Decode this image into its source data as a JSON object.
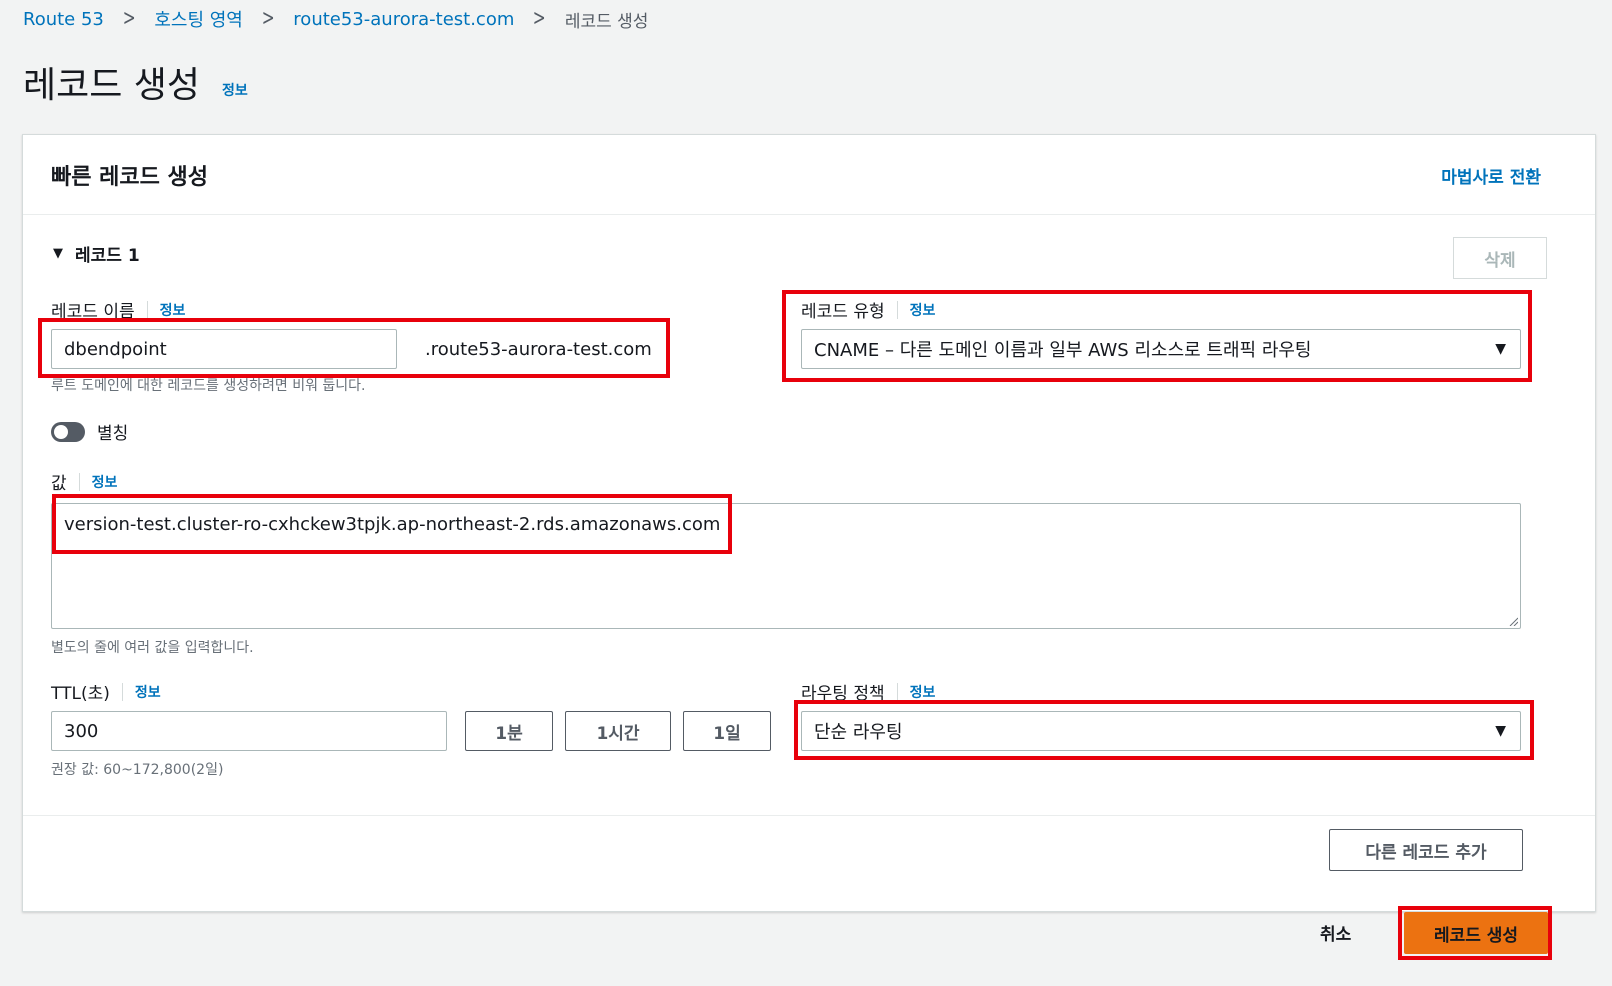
{
  "breadcrumb": {
    "items": [
      "Route 53",
      "호스팅 영역",
      "route53-aurora-test.com",
      "레코드 생성"
    ],
    "separator": ">"
  },
  "page": {
    "title": "레코드 생성",
    "info": "정보"
  },
  "panel": {
    "title": "빠른 레코드 생성",
    "wizard_link": "마법사로 전환"
  },
  "record": {
    "heading": "레코드 1",
    "delete_label": "삭제",
    "name": {
      "label": "레코드 이름",
      "info": "정보",
      "value": "dbendpoint",
      "domain_suffix": ".route53-aurora-test.com",
      "hint": "루트 도메인에 대한 레코드를 생성하려면 비워 둡니다."
    },
    "type": {
      "label": "레코드 유형",
      "info": "정보",
      "value": "CNAME – 다른 도메인 이름과 일부 AWS 리소스로 트래픽 라우팅"
    },
    "alias": {
      "label": "별칭",
      "enabled": false
    },
    "value": {
      "label": "값",
      "info": "정보",
      "text": "version-test.cluster-ro-cxhckew3tpjk.ap-northeast-2.rds.amazonaws.com",
      "hint": "별도의 줄에 여러 값을 입력합니다."
    },
    "ttl": {
      "label": "TTL(초)",
      "info": "정보",
      "value": "300",
      "buttons": [
        "1분",
        "1시간",
        "1일"
      ],
      "hint": "권장 값: 60~172,800(2일)"
    },
    "routing": {
      "label": "라우팅 정책",
      "info": "정보",
      "value": "단순 라우팅"
    }
  },
  "actions": {
    "add_record": "다른 레코드 추가",
    "cancel": "취소",
    "create": "레코드 생성"
  },
  "colors": {
    "link": "#0073bb",
    "primary_button": "#ec7211",
    "highlight": "#e8000b"
  }
}
